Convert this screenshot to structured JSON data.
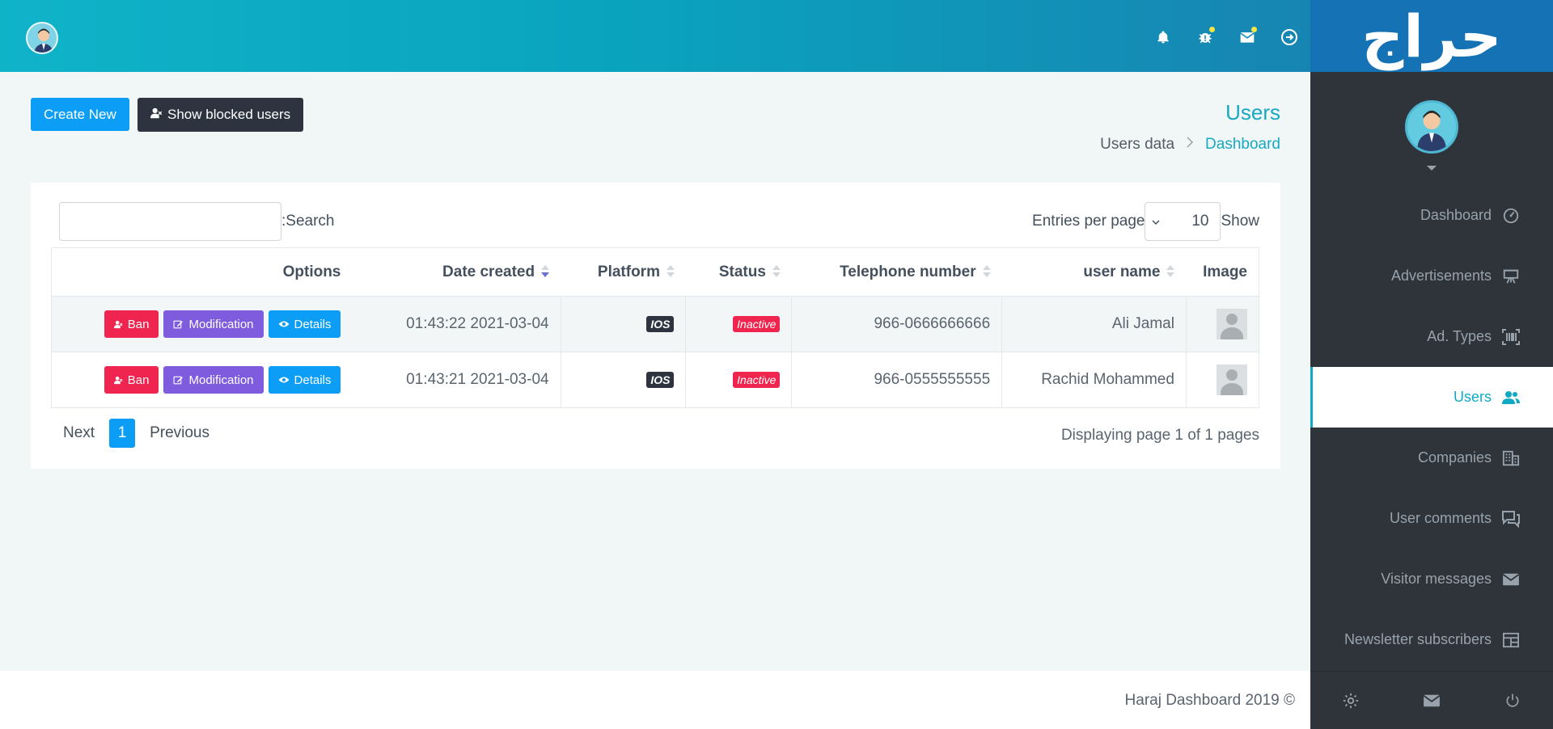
{
  "topbar": {
    "icons": [
      "bell-icon",
      "bug-icon",
      "mail-icon",
      "logout-icon"
    ]
  },
  "sidebar": {
    "logo_text": "حراج",
    "nav": [
      {
        "label": "Dashboard",
        "icon": "speedometer-icon"
      },
      {
        "label": "Advertisements",
        "icon": "easel-icon"
      },
      {
        "label": "Ad. Types",
        "icon": "barcode-icon"
      },
      {
        "label": "Users",
        "icon": "users-icon",
        "active": true
      },
      {
        "label": "Companies",
        "icon": "building-icon"
      },
      {
        "label": "User comments",
        "icon": "comments-icon"
      },
      {
        "label": "Visitor messages",
        "icon": "envelope-icon"
      },
      {
        "label": "Newsletter subscribers",
        "icon": "table-icon"
      }
    ],
    "bottom_icons": [
      "gear-icon",
      "mail-icon",
      "power-icon"
    ]
  },
  "header": {
    "create_label": "Create New",
    "blocked_label": "Show blocked users",
    "title": "Users",
    "breadcrumb": {
      "current": "Users data",
      "home": "Dashboard"
    }
  },
  "table_controls": {
    "search_label": ":Search",
    "search_value": "",
    "entries_label": "Entries per page",
    "entries_value": "10",
    "show_label": "Show"
  },
  "table": {
    "headers": {
      "options": "Options",
      "date": "Date created",
      "platform": "Platform",
      "status": "Status",
      "phone": "Telephone number",
      "username": "user name",
      "image": "Image"
    },
    "actions": {
      "ban": "Ban",
      "modification": "Modification",
      "details": "Details"
    },
    "rows": [
      {
        "date": "01:43:22 2021-03-04",
        "platform": "IOS",
        "status": "Inactive",
        "phone": "966-0666666666",
        "username": "Ali Jamal"
      },
      {
        "date": "01:43:21 2021-03-04",
        "platform": "IOS",
        "status": "Inactive",
        "phone": "966-0555555555",
        "username": "Rachid Mohammed"
      }
    ]
  },
  "pagination": {
    "next": "Next",
    "current_page": "1",
    "previous": "Previous",
    "info": "Displaying page 1 of 1 pages"
  },
  "footer": {
    "text": "Haraj Dashboard 2019 ©"
  },
  "colors": {
    "accent": "#17a9c2",
    "primary_button": "#0c9ef7",
    "danger": "#f0254f",
    "purple": "#7f5bde",
    "dark": "#2d3440"
  }
}
